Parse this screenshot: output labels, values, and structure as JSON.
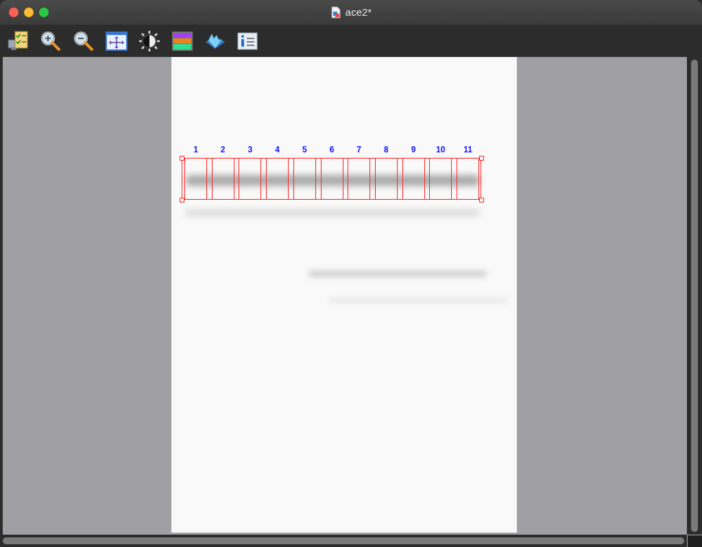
{
  "window": {
    "title": "ace2*"
  },
  "lanes": [
    {
      "label": "1"
    },
    {
      "label": "2"
    },
    {
      "label": "3"
    },
    {
      "label": "4"
    },
    {
      "label": "5"
    },
    {
      "label": "6"
    },
    {
      "label": "7"
    },
    {
      "label": "8"
    },
    {
      "label": "9"
    },
    {
      "label": "10"
    },
    {
      "label": "11"
    }
  ]
}
